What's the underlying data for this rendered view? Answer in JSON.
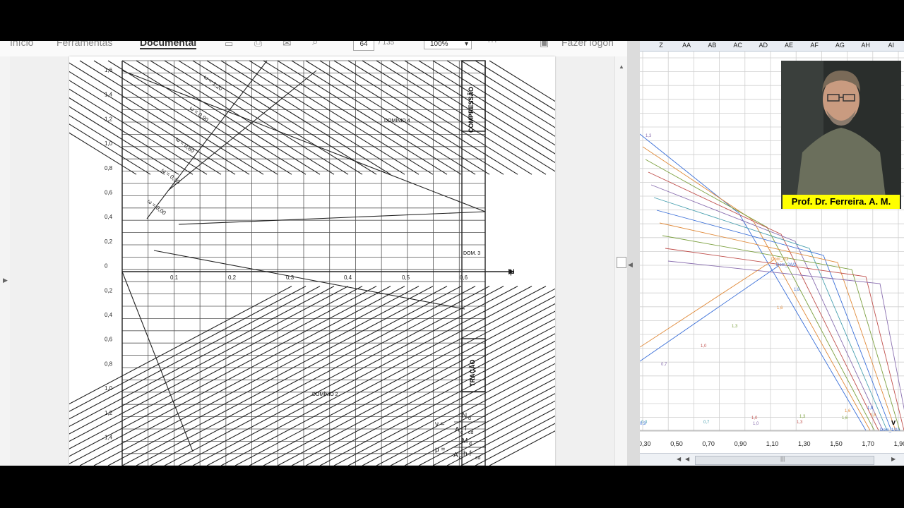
{
  "pdf_toolbar": {
    "home": "Início",
    "tools": "Ferramentas",
    "document": "Documental",
    "page_current": "64",
    "page_total": "/ 135",
    "zoom": "100%",
    "more": "···",
    "login": "Fazer logon"
  },
  "page": {
    "axis_mu": "μ",
    "y_ticks": [
      "1,6",
      "1,4",
      "1,2",
      "1,0",
      "0,8",
      "0,6",
      "0,4",
      "0,2",
      "0",
      "0,2",
      "0,4",
      "0,6",
      "0,8",
      "1,0",
      "1,2",
      "1,4"
    ],
    "x_ticks": [
      "0,1",
      "0,2",
      "0,3",
      "0,4",
      "0,5",
      "0,6"
    ],
    "omega_labels": [
      "ω = 1,20",
      "ω = 0,90",
      "ω = 0,60",
      "ω = 0,30",
      "ω = 0,00"
    ],
    "compressao": "COMPRESSÃO",
    "tracao": "TRAÇÃO",
    "dominio4": "DOMÍNIO 4",
    "dominio2": "DOMÍNIO 2",
    "dom3": "DOM. 3",
    "nu_label": "ν =",
    "nu_num": "N",
    "nu_num_sub": "d",
    "nu_den": "A",
    "nu_den_sub": "c",
    "nu_den_f": "f",
    "nu_den_fsub": "cd",
    "mu_label": "μ =",
    "mu_num": "M",
    "mu_num_sub": "d",
    "mu_den": "A",
    "mu_den_sub": "c",
    "mu_den_h": "h f",
    "mu_den_fsub": "cd"
  },
  "excel": {
    "columns": [
      "Z",
      "AA",
      "AB",
      "AC",
      "AD",
      "AE",
      "AF",
      "AG",
      "AH",
      "AI"
    ],
    "x_ticks": [
      "0,30",
      "0,50",
      "0,70",
      "0,90",
      "1,10",
      "1,30",
      "1,50",
      "1,70",
      "1,90"
    ],
    "axis_v": "v",
    "dom_23": "Dom_2/3",
    "dom_2a2": "Dom_2A/2",
    "dom_12a": "Dom_1/2A",
    "curve_labels": [
      "1,8",
      "1,6",
      "1,3",
      "1,0",
      "0,7",
      "0,3",
      "1,8",
      "1,6",
      "1,3",
      "1,0",
      "1,0",
      "0,7",
      "0,3",
      "1,8",
      "1,6",
      "1,3",
      "1,3"
    ],
    "caption": "Prof. Dr. Ferreira. A. M."
  },
  "colors": {
    "caption_bg": "#ffff00",
    "series_blue": "#3a6fd8",
    "series_orange": "#e08a3a",
    "series_green": "#7ca040",
    "series_red": "#c0504d"
  }
}
